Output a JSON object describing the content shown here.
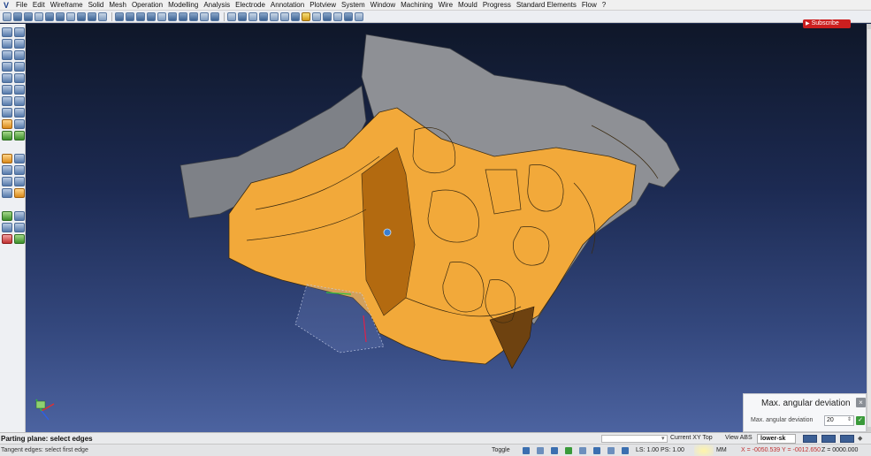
{
  "menubar": {
    "app_icon": "app-logo-icon",
    "items": [
      "File",
      "Edit",
      "Wireframe",
      "Solid",
      "Mesh",
      "Operation",
      "Modelling",
      "Analysis",
      "Electrode",
      "Annotation",
      "Plotview",
      "System",
      "Window",
      "Machining",
      "Wire",
      "Mould",
      "Progress",
      "Standard Elements",
      "Flow",
      "?"
    ]
  },
  "overlay": {
    "subscribe_label": "Subscribe",
    "subscribe_icon": "youtube-play-icon"
  },
  "deviation_panel": {
    "title": "Max. angular deviation",
    "field_label": "Max. angular deviation",
    "field_value": "20",
    "close_icon": "close-icon",
    "ok_icon": "checkmark-icon"
  },
  "status": {
    "prompt": "Parting plane: select edges",
    "hint": "Tangent edges: select first edge",
    "view_current": "Current XY Top",
    "view_abs": "View ABS",
    "layer": "lower-sk",
    "toggle": "Toggle",
    "ls_ps": "LS: 1.00 PS: 1.00",
    "units": "MM",
    "xy_coords": "X = -0050.539 Y = -0012.650",
    "z_coord": "Z = 0000.000"
  },
  "colors": {
    "model_face": "#f2a93a",
    "model_gray": "#8e9095",
    "viewport_top": "#0f1729",
    "viewport_bottom": "#4c63a0",
    "accent": "#cc1f1f"
  }
}
